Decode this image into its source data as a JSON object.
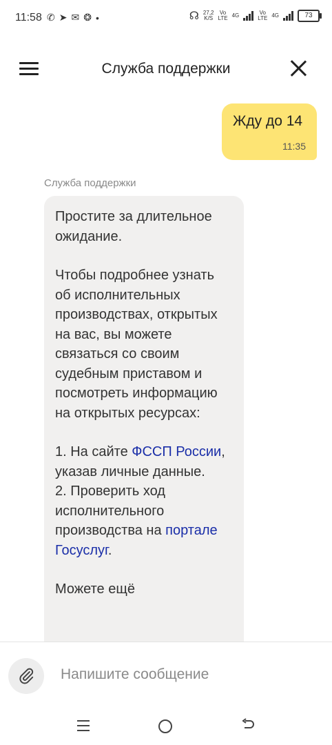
{
  "statusbar": {
    "time": "11:58",
    "speed_value": "27,2",
    "speed_unit": "K/S",
    "sim1_label_top": "Vo",
    "sim1_label_bottom": "LTE",
    "sim1_net": "4G",
    "sim2_label_top": "Vo",
    "sim2_label_bottom": "LTE",
    "sim2_net": "4G",
    "battery": "73"
  },
  "header": {
    "title": "Служба поддержки"
  },
  "chat": {
    "outgoing": {
      "text": "Жду до 14",
      "time": "11:35"
    },
    "incoming": {
      "sender": "Служба поддержки",
      "para1": "Простите за длительное ожидание.",
      "para2": "Чтобы подробнее узнать об исполнительных производствах, открытых на вас, вы можете связаться со своим судебным приставом и посмотреть информацию на открытых ресурсах:",
      "item1_prefix": "1. На сайте ",
      "item1_link": "ФССП России",
      "item1_suffix": ", указав личные данные.",
      "item2_prefix": "2. Проверить ход исполнительного производства на ",
      "item2_link": "портале Госуслуг",
      "item2_suffix": ".",
      "para_cut": "Можете ещё"
    }
  },
  "composer": {
    "placeholder": "Напишите сообщение"
  },
  "colors": {
    "outgoing_bubble": "#fde474",
    "incoming_bubble": "#f1f0ef",
    "link": "#1a2ea8"
  }
}
